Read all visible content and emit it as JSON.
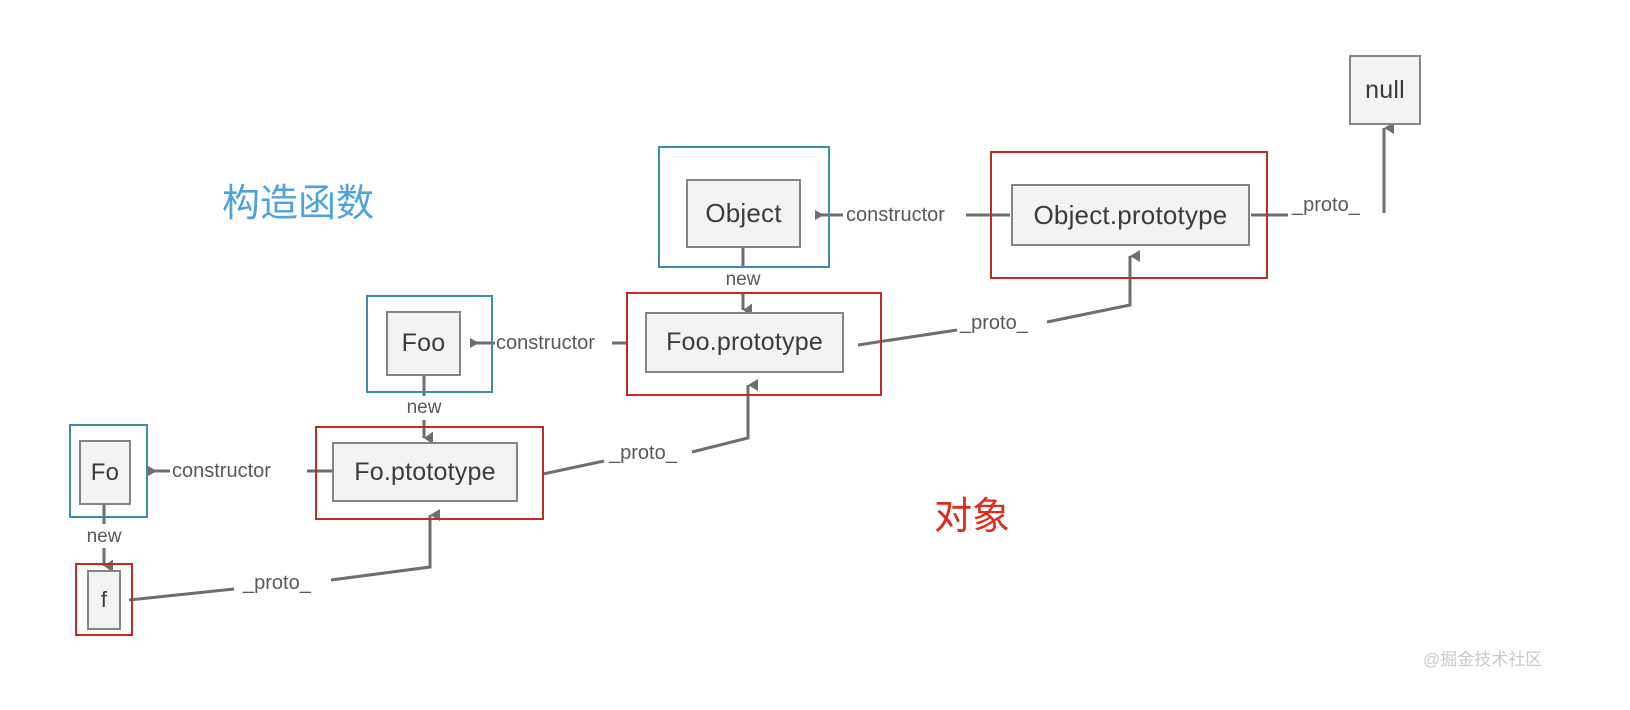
{
  "diagram": {
    "title_blue": "构造函数",
    "title_red": "对象",
    "watermark": "@掘金技术社区",
    "colors": {
      "constructor_frame": "#3f8ca8",
      "object_frame": "#bf2c28",
      "node_border": "#848484",
      "node_fill": "#f3f3f3",
      "edge": "#6e6e6e",
      "heading_blue": "#4fa3dc",
      "heading_red": "#e02a1c"
    },
    "nodes": [
      {
        "id": "null",
        "label": "null"
      },
      {
        "id": "object",
        "label": "Object"
      },
      {
        "id": "object_prototype",
        "label": "Object.prototype"
      },
      {
        "id": "foo",
        "label": "Foo"
      },
      {
        "id": "foo_prototype",
        "label": "Foo.prototype"
      },
      {
        "id": "fo",
        "label": "Fo"
      },
      {
        "id": "fo_prototype",
        "label": "Fo.ptototype"
      },
      {
        "id": "f",
        "label": "f"
      }
    ],
    "edges": [
      {
        "id": "e1",
        "from": "object_prototype",
        "to": "object",
        "label": "constructor"
      },
      {
        "id": "e2",
        "from": "foo_prototype",
        "to": "foo",
        "label": "constructor"
      },
      {
        "id": "e3",
        "from": "fo_prototype",
        "to": "fo",
        "label": "constructor"
      },
      {
        "id": "e4",
        "from": "object",
        "to": "foo_prototype",
        "label": "new"
      },
      {
        "id": "e5",
        "from": "foo",
        "to": "fo_prototype",
        "label": "new"
      },
      {
        "id": "e6",
        "from": "fo",
        "to": "f",
        "label": "new"
      },
      {
        "id": "e7",
        "from": "object_prototype",
        "to": "null",
        "label": "_proto_"
      },
      {
        "id": "e8",
        "from": "foo_prototype",
        "to": "object_prototype",
        "label": "_proto_"
      },
      {
        "id": "e9",
        "from": "fo_prototype",
        "to": "foo_prototype",
        "label": "_proto_"
      },
      {
        "id": "e10",
        "from": "f",
        "to": "fo_prototype",
        "label": "_proto_"
      }
    ]
  }
}
